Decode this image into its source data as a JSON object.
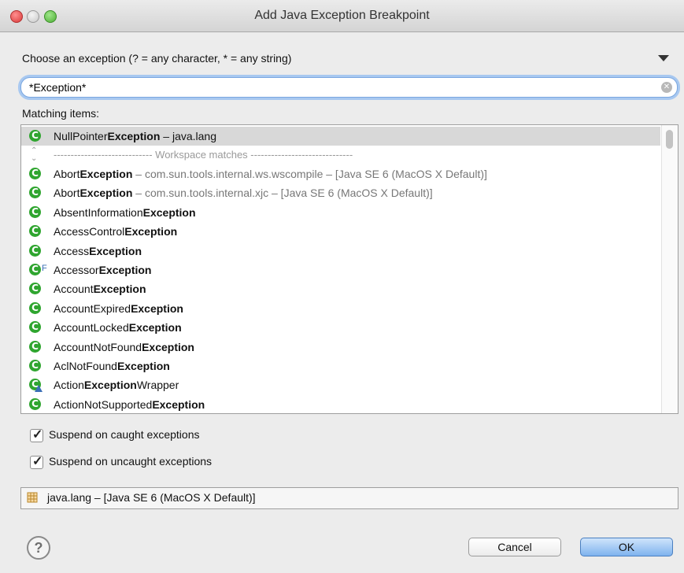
{
  "window": {
    "title": "Add Java Exception Breakpoint"
  },
  "prompt": "Choose an exception (? = any character, * = any string)",
  "search": {
    "value": "*Exception*"
  },
  "matching_label": "Matching items:",
  "list": {
    "history_item": {
      "plain": "NullPointer",
      "bold": "Exception",
      "pkg": " – java.lang"
    },
    "separator": "----------------------------- Workspace matches ------------------------------",
    "items": [
      {
        "pre": "Abort",
        "bold": "Exception",
        "post": "",
        "pkg": " – com.sun.tools.internal.ws.wscompile – [Java SE 6 (MacOS X Default)]"
      },
      {
        "pre": "Abort",
        "bold": "Exception",
        "post": "",
        "pkg": " – com.sun.tools.internal.xjc – [Java SE 6 (MacOS X Default)]"
      },
      {
        "pre": "AbsentInformation",
        "bold": "Exception",
        "post": "",
        "pkg": ""
      },
      {
        "pre": "AccessControl",
        "bold": "Exception",
        "post": "",
        "pkg": ""
      },
      {
        "pre": "Access",
        "bold": "Exception",
        "post": "",
        "pkg": ""
      },
      {
        "pre": "Accessor",
        "bold": "Exception",
        "post": "",
        "pkg": ""
      },
      {
        "pre": "Account",
        "bold": "Exception",
        "post": "",
        "pkg": ""
      },
      {
        "pre": "AccountExpired",
        "bold": "Exception",
        "post": "",
        "pkg": ""
      },
      {
        "pre": "AccountLocked",
        "bold": "Exception",
        "post": "",
        "pkg": ""
      },
      {
        "pre": "AccountNotFound",
        "bold": "Exception",
        "post": "",
        "pkg": ""
      },
      {
        "pre": "AclNotFound",
        "bold": "Exception",
        "post": "",
        "pkg": ""
      },
      {
        "pre": "Action",
        "bold": "Exception",
        "post": "Wrapper",
        "pkg": ""
      },
      {
        "pre": "ActionNotSupported",
        "bold": "Exception",
        "post": "",
        "pkg": ""
      }
    ],
    "final_marker": "F"
  },
  "options": {
    "caught_label": "Suspend on caught exceptions",
    "uncaught_label": "Suspend on uncaught exceptions"
  },
  "status": "java.lang – [Java SE 6 (MacOS X Default)]",
  "buttons": {
    "help": "?",
    "cancel": "Cancel",
    "ok": "OK"
  },
  "colors": {
    "class_icon": "#2fa52f",
    "selection": "#d8d8d8",
    "focus_ring": "#a8c8f0",
    "default_button": "#7fb3ee"
  }
}
